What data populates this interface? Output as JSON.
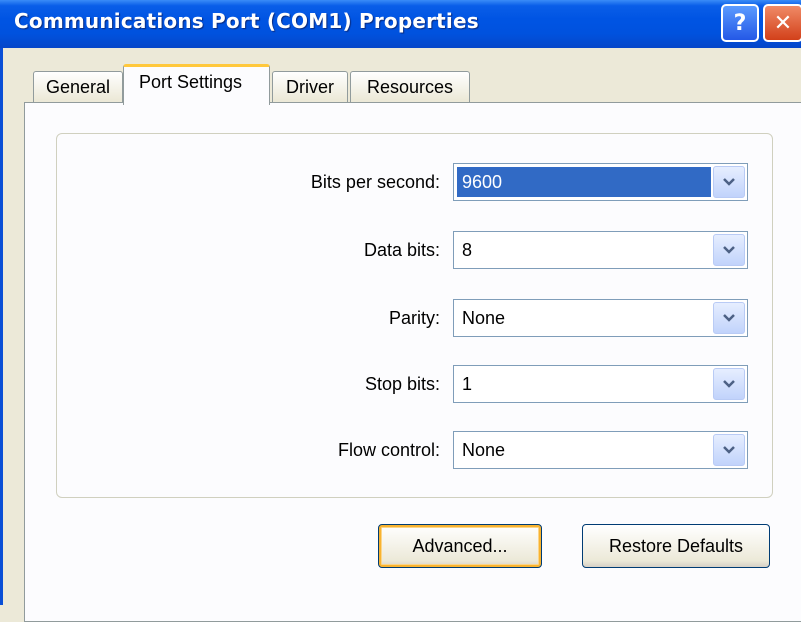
{
  "window": {
    "title": "Communications Port (COM1) Properties",
    "help_label": "?",
    "close_label": "✕"
  },
  "tabs": [
    {
      "label": "General",
      "active": false
    },
    {
      "label": "Port Settings",
      "active": true
    },
    {
      "label": "Driver",
      "active": false
    },
    {
      "label": "Resources",
      "active": false
    }
  ],
  "settings": [
    {
      "label": "Bits per second:",
      "value": "9600",
      "selected": true
    },
    {
      "label": "Data bits:",
      "value": "8",
      "selected": false
    },
    {
      "label": "Parity:",
      "value": "None",
      "selected": false
    },
    {
      "label": "Stop bits:",
      "value": "1",
      "selected": false
    },
    {
      "label": "Flow control:",
      "value": "None",
      "selected": false
    }
  ],
  "buttons": {
    "advanced": "Advanced...",
    "restore_defaults": "Restore Defaults"
  },
  "colors": {
    "titlebar": "#0054e3",
    "selection": "#316ac5",
    "active_tab_accent": "#ffc83c"
  }
}
